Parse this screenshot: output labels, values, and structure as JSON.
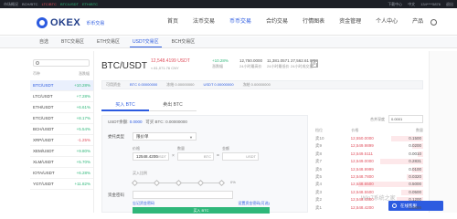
{
  "ticker": {
    "items": [
      {
        "label": "市场概况",
        "cls": ""
      },
      {
        "label": "BCH/BTC",
        "cls": ""
      },
      {
        "label": "LTC/BTC",
        "cls": "r"
      },
      {
        "label": "BTC/USDT",
        "cls": "g"
      },
      {
        "label": "ETH/BTC",
        "cls": "g"
      }
    ],
    "right": [
      "下载中心",
      "中文",
      "134****5876",
      "退出"
    ]
  },
  "nav": {
    "logo": "OKEX",
    "logo_sub": "币币交易",
    "links": [
      "首页",
      "法币交易",
      "币币交易",
      "合约交易",
      "行情图表",
      "资金管理",
      "个人中心",
      "产品"
    ],
    "active_index": 2
  },
  "subtabs": {
    "items": [
      "自选",
      "BTC交易区",
      "ETH交易区",
      "USDT交易区",
      "BCH交易区"
    ],
    "active_index": 3
  },
  "sidebar": {
    "head_left": "币种",
    "head_right": "涨跌幅",
    "rows": [
      {
        "sym": "BTC/USDT",
        "chg": "+10.28%",
        "dir": "up"
      },
      {
        "sym": "LTC/USDT",
        "chg": "+7.28%",
        "dir": "up"
      },
      {
        "sym": "ETH/USDT",
        "chg": "+6.61%",
        "dir": "up"
      },
      {
        "sym": "ETC/USDT",
        "chg": "+8.17%",
        "dir": "up"
      },
      {
        "sym": "BCH/USDT",
        "chg": "+5.54%",
        "dir": "up"
      },
      {
        "sym": "XRP/USDT",
        "chg": "-1.25%",
        "dir": "down"
      },
      {
        "sym": "XEM/USDT",
        "chg": "+9.80%",
        "dir": "up"
      },
      {
        "sym": "XLM/USDT",
        "chg": "+5.70%",
        "dir": "up"
      },
      {
        "sym": "IOTA/USDT",
        "chg": "+6.28%",
        "dir": "up"
      },
      {
        "sym": "YGT/USDT",
        "chg": "+11.82%",
        "dir": "up"
      }
    ],
    "active_index": 0
  },
  "header": {
    "pair": "BTC/USDT",
    "price": "12,548.4199 USDT",
    "price_sub": "≈ 81,071.76 CNY",
    "stats": [
      {
        "label": "涨跌幅",
        "value": "+10.28%"
      },
      {
        "label": "24小时最高价",
        "value": "12,750.0000"
      },
      {
        "label": "24小时最低价",
        "value": "11,381.0571"
      },
      {
        "label": "24小时成交量",
        "value": "27,562.61 BTC"
      }
    ]
  },
  "account_bar": {
    "items": [
      "可用资金",
      "BTC 0.00000000",
      "冻结 0.00000000",
      "USDT 0.00000000",
      "冻结 0.00000000"
    ]
  },
  "trade_tabs": [
    "买入 BTC",
    "卖出 BTC"
  ],
  "order": {
    "balance_label": "USDT余额: ",
    "balance_value": "0.0000",
    "buyable_label": "可买 BTC: ",
    "buyable_value": "0.00000000",
    "type_label": "委托类型",
    "type_value": "限价单",
    "price_label": "价格",
    "price_value": "12548.4200",
    "price_unit": "USDT",
    "qty_label": "数量",
    "qty_unit": "BTC",
    "amount_label": "金额",
    "amount_unit": "USDT",
    "buy_ratio_label": "买入比例",
    "buy_ratio_value": "0%",
    "pwd_label": "资金密码",
    "forgot_pwd": "忘记资金密码",
    "set_pwd": "设置资金密码(可选)",
    "buy_button": "买入 BTC"
  },
  "orderbook": {
    "depth_label": "合并深度",
    "depth_value": "0.0001",
    "head": [
      "档位",
      "价格",
      "数量"
    ],
    "rows": [
      {
        "lbl": "卖10",
        "p": "12,550.0000",
        "q": "0.1500",
        "depth": 0.3
      },
      {
        "lbl": "卖9",
        "p": "12,549.9899",
        "q": "0.0200",
        "depth": 0.1
      },
      {
        "lbl": "卖8",
        "p": "12,549.5111",
        "q": "0.0010",
        "depth": 0.05
      },
      {
        "lbl": "卖7",
        "p": "12,549.0000",
        "q": "0.2831",
        "depth": 0.4
      },
      {
        "lbl": "卖6",
        "p": "12,548.9999",
        "q": "0.0100",
        "depth": 0.1
      },
      {
        "lbl": "卖5",
        "p": "12,548.7800",
        "q": "0.0320",
        "depth": 0.15
      },
      {
        "lbl": "卖4",
        "p": "12,548.6500",
        "q": "0.5000",
        "depth": 0.6
      },
      {
        "lbl": "卖3",
        "p": "12,548.5500",
        "q": "0.0500",
        "depth": 0.2
      },
      {
        "lbl": "卖2",
        "p": "12,548.4300",
        "q": "0.1200",
        "depth": 0.25
      },
      {
        "lbl": "卖1",
        "p": "12,548.4200",
        "q": "0.0866",
        "depth": 0.2
      }
    ]
  },
  "help_button": "在线客服",
  "watermark": "Win7系统之家"
}
